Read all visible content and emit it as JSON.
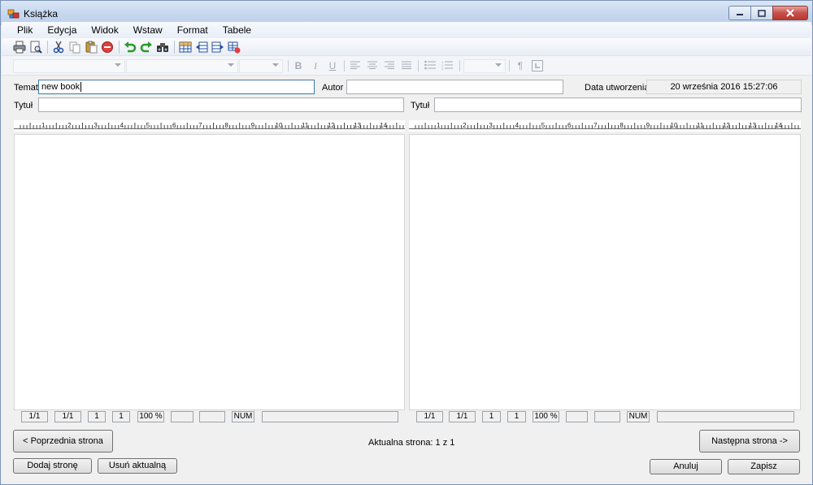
{
  "window": {
    "title": "Książka"
  },
  "menu": [
    "Plik",
    "Edycja",
    "Widok",
    "Wstaw",
    "Format",
    "Tabele"
  ],
  "toolbar": {
    "icons": [
      "print-icon",
      "print-preview-icon",
      "cut-icon",
      "copy-icon",
      "paste-icon",
      "delete-icon",
      "undo-icon",
      "redo-icon",
      "find-icon",
      "table-icon",
      "insert-row-left-icon",
      "insert-row-right-icon",
      "table-delete-icon"
    ]
  },
  "format_bar": {
    "bold": "B",
    "italic": "I",
    "underline": "U",
    "pilcrow": "¶"
  },
  "form": {
    "topic_label": "Temat",
    "topic_value": "new book",
    "author_label": "Autor",
    "author_value": "",
    "created_label": "Data utworzenia",
    "created_value": "20 września 2016 15:27:06",
    "title_left_label": "Tytuł",
    "title_right_label": "Tytuł"
  },
  "ruler": {
    "numbers": [
      "1",
      "2",
      "3",
      "4",
      "5",
      "6",
      "7",
      "8",
      "9",
      "10",
      "11",
      "12",
      "13",
      "14"
    ]
  },
  "status_left": [
    "1/1",
    "1/1",
    "1",
    "1",
    "100 %",
    "",
    "",
    "NUM",
    ""
  ],
  "status_right": [
    "1/1",
    "1/1",
    "1",
    "1",
    "100 %",
    "",
    "",
    "NUM",
    ""
  ],
  "nav": {
    "prev": "< Poprzednia strona",
    "current": "Aktualna strona: 1 z 1",
    "next": "Następna strona ->"
  },
  "actions": {
    "add": "Dodaj stronę",
    "remove": "Usuń aktualną",
    "cancel": "Anuluj",
    "save": "Zapisz"
  },
  "colors": {
    "accent": "#3d7bad",
    "titlebar": "#c7d8ef"
  }
}
